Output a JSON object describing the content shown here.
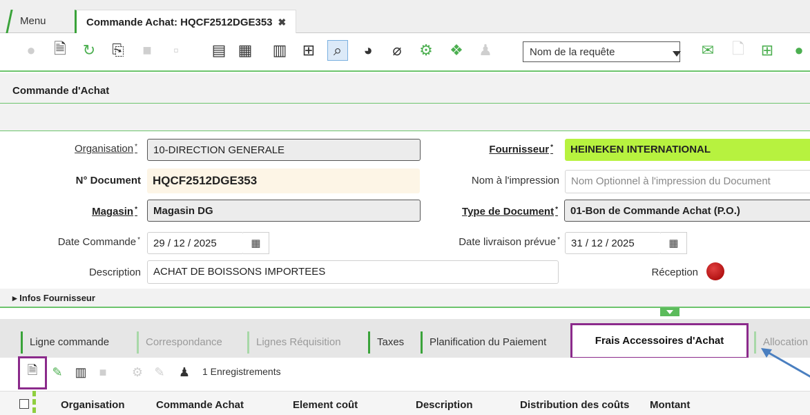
{
  "tabs": {
    "menu": "Menu",
    "active": "Commande Achat: HQCF2512DGE353",
    "close": "✖"
  },
  "toolbar": {
    "query_placeholder": "Nom de la requête"
  },
  "section": {
    "title": "Commande d'Achat",
    "infos_fournisseur": "Infos Fournisseur"
  },
  "form": {
    "organisation_label": "Organisation",
    "organisation_value": "10-DIRECTION GENERALE",
    "fournisseur_label": "Fournisseur",
    "fournisseur_value": "HEINEKEN INTERNATIONAL",
    "document_label": "N° Document",
    "document_value": "HQCF2512DGE353",
    "nom_impression_label": "Nom à l'impression",
    "nom_impression_placeholder": "Nom Optionnel à l'impression du Document",
    "magasin_label": "Magasin",
    "magasin_value": "Magasin DG",
    "type_document_label": "Type de Document",
    "type_document_value": "01-Bon de Commande Achat (P.O.)",
    "date_commande_label": "Date Commande",
    "date_commande_value": "29 / 12 / 2025",
    "date_livraison_label": "Date livraison prévue",
    "date_livraison_value": "31 / 12 / 2025",
    "description_label": "Description",
    "description_value": "ACHAT DE BOISSONS IMPORTEES",
    "reception_label": "Réception",
    "required_mark": "*"
  },
  "subtabs": [
    {
      "label": "Ligne commande"
    },
    {
      "label": "Correspondance"
    },
    {
      "label": "Lignes Réquisition"
    },
    {
      "label": "Taxes"
    },
    {
      "label": "Planification du Paiement"
    },
    {
      "label": "Frais Accessoires d'Achat"
    },
    {
      "label": "Allocation"
    }
  ],
  "grid": {
    "count": "1 Enregistrements",
    "columns": [
      "Organisation",
      "Commande Achat",
      "Element coût",
      "Description",
      "Distribution des coûts",
      "Montant"
    ]
  },
  "colors": {
    "accent_green": "#4caf50",
    "highlight_purple": "#8b2a8b",
    "supplier_lime": "#b7f23f",
    "arrow_blue": "#4a7fc0"
  },
  "icons": [
    "refresh-icon",
    "new-record-icon",
    "undo-icon",
    "copy-icon",
    "save-icon",
    "save-new-icon",
    "print-icon",
    "grid-toggle-icon",
    "delete-icon",
    "expand-icon",
    "search-icon",
    "chart-icon",
    "attachment-icon",
    "process-icon",
    "archive-icon",
    "user-icon",
    "mail-icon",
    "document-icon",
    "workflow-icon",
    "whatsapp-icon",
    "calendar-icon"
  ]
}
